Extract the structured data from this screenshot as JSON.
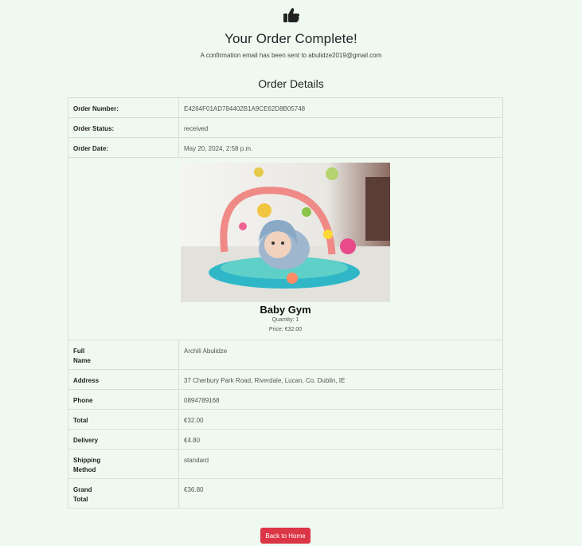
{
  "header": {
    "icon": "thumbs-up-icon",
    "title": "Your Order Complete!",
    "subtitle": "A confirmation email has been sent to abulidze2019@gmail.com"
  },
  "details_title": "Order Details",
  "order": {
    "number_label": "Order Number:",
    "number": "E4264F01AD784402B1A9CE62D8B05748",
    "status_label": "Order Status:",
    "status": "received",
    "date_label": "Order Date:",
    "date": "May 20, 2024, 2:58 p.m."
  },
  "product": {
    "name": "Baby Gym",
    "quantity": "Quantity: 1",
    "price": "Price: €32.00"
  },
  "customer": {
    "full_name_label_1": "Full",
    "full_name_label_2": "Name",
    "full_name": "Archili Abulidze",
    "address_label": "Address",
    "address": "37 Cherbury Park Road, Riverdale, Lucan, Co. Dublin, IE",
    "phone_label": "Phone",
    "phone": "0894789168",
    "total_label": "Total",
    "total": "€32.00",
    "delivery_label": "Delivery",
    "delivery": "€4.80",
    "shipping_label_1": "Shipping",
    "shipping_label_2": "Method",
    "shipping": "standard",
    "grand_total_label_1": "Grand",
    "grand_total_label_2": "Total",
    "grand_total": "€36.80"
  },
  "actions": {
    "back_home": "Back to Home"
  },
  "colors": {
    "background": "#f0f9ef",
    "button": "#dc3545"
  }
}
